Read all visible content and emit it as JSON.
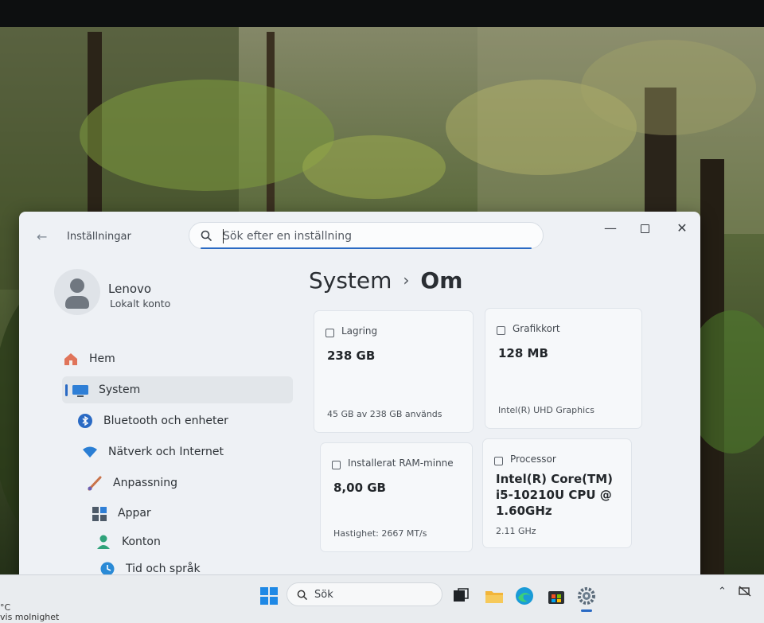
{
  "window": {
    "title": "Inställningar",
    "back_icon": "arrow-left-icon",
    "controls": {
      "minimize_icon": "minimize-icon",
      "maximize_icon": "maximize-icon",
      "close_icon": "close-icon"
    }
  },
  "search": {
    "placeholder": "Sök efter en inställning",
    "value": ""
  },
  "profile": {
    "name": "Lenovo",
    "account_type": "Lokalt konto"
  },
  "sidebar": {
    "items": [
      {
        "label": "Hem",
        "icon": "home-icon",
        "active": false
      },
      {
        "label": "System",
        "icon": "monitor-icon",
        "active": true
      },
      {
        "label": "Bluetooth och enheter",
        "icon": "bluetooth-icon",
        "active": false
      },
      {
        "label": "Nätverk och Internet",
        "icon": "wifi-icon",
        "active": false
      },
      {
        "label": "Anpassning",
        "icon": "brush-icon",
        "active": false
      },
      {
        "label": "Appar",
        "icon": "apps-icon",
        "active": false
      },
      {
        "label": "Konton",
        "icon": "account-icon",
        "active": false
      },
      {
        "label": "Tid och språk",
        "icon": "clock-globe-icon",
        "active": false
      }
    ]
  },
  "breadcrumb": {
    "parent": "System",
    "separator": "›",
    "current": "Om"
  },
  "specs": {
    "storage": {
      "label": "Lagring",
      "value": "238 GB",
      "footer": "45 GB av 238 GB används",
      "icon": "storage-icon"
    },
    "gpu": {
      "label": "Grafikkort",
      "value": "128 MB",
      "footer": "Intel(R) UHD Graphics",
      "icon": "gpu-icon"
    },
    "ram": {
      "label": "Installerat RAM-minne",
      "value": "8,00 GB",
      "footer": "Hastighet: 2667 MT/s",
      "icon": "ram-icon"
    },
    "cpu": {
      "label": "Processor",
      "value_lines": [
        "Intel(R) Core(TM)",
        "i5-10210U CPU @",
        "1.60GHz"
      ],
      "footer": "2.11 GHz",
      "icon": "cpu-icon"
    }
  },
  "taskbar": {
    "search_label": "Sök",
    "weather_line1": "°C",
    "weather_line2": "vis molnighet",
    "pinned": [
      "windows-start-icon",
      "task-view-icon",
      "file-explorer-icon",
      "edge-icon",
      "store-icon",
      "settings-icon"
    ],
    "tray": [
      "chevron-up-icon",
      "network-offline-icon"
    ]
  },
  "colors": {
    "accent": "#2a6ac4",
    "window_bg": "#eef1f5",
    "card_bg": "#f6f8fa"
  }
}
